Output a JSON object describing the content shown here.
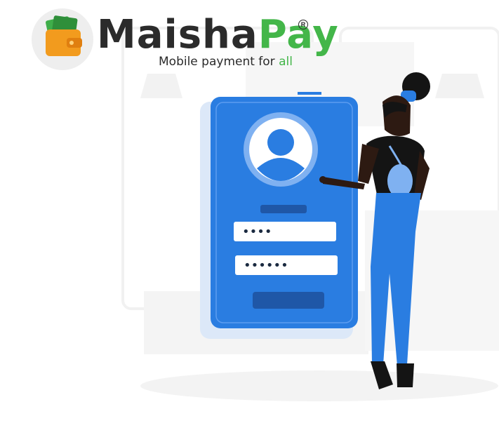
{
  "brand": {
    "name_part1": "Maisha",
    "name_part2": "Pay",
    "registered": "R",
    "tagline_main": "Mobile payment for ",
    "tagline_accent": "all",
    "logo_icon": "wallet-icon"
  },
  "illustration": {
    "password_dots": [
      "••••",
      "••••••"
    ],
    "avatar_icon": "user-avatar-icon"
  },
  "colors": {
    "brand_dark": "#2b2b2b",
    "brand_green": "#43b649",
    "phone_blue": "#2a7de1",
    "phone_dark": "#1f57a7"
  }
}
